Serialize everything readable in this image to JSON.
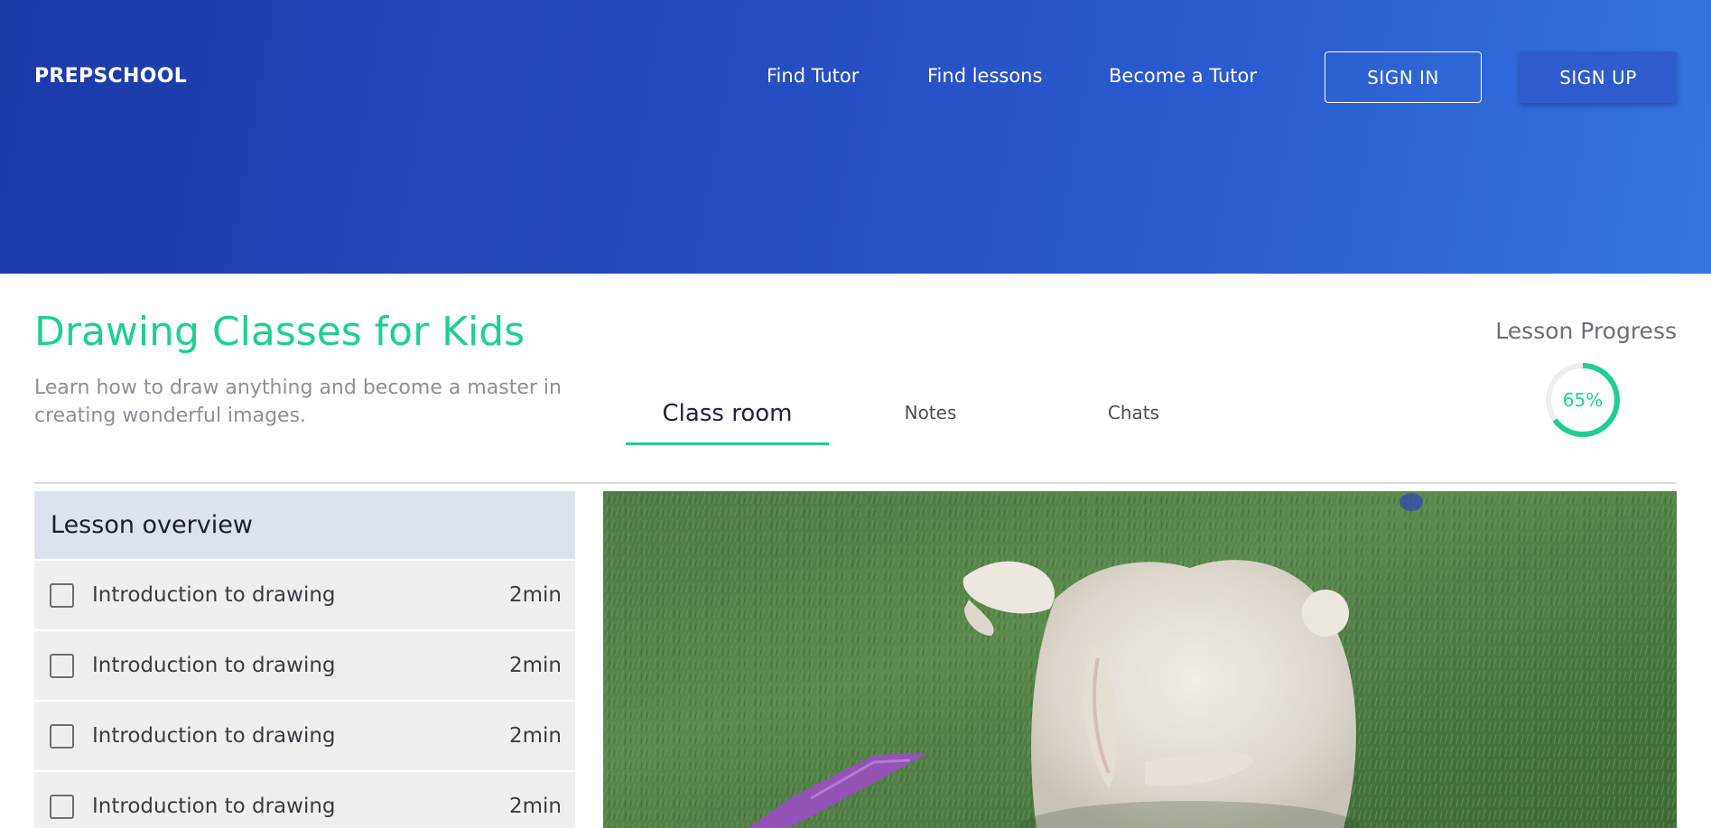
{
  "header": {
    "brand": "PREPSCHOOL",
    "nav": [
      "Find Tutor",
      "Find lessons",
      "Become a Tutor"
    ],
    "sign_in": "SIGN IN",
    "sign_up": "SIGN UP"
  },
  "course": {
    "title": "Drawing Classes for Kids",
    "description": "Learn how to draw anything and become a master in creating wonderful images."
  },
  "tabs": [
    {
      "label": "Class room",
      "active": true
    },
    {
      "label": "Notes",
      "active": false
    },
    {
      "label": "Chats",
      "active": false
    }
  ],
  "progress": {
    "label": "Lesson Progress",
    "value_text": "65%",
    "value": 0.65
  },
  "overview": {
    "title": "Lesson overview",
    "items": [
      {
        "name": "Introduction to drawing",
        "duration": "2min",
        "checked": false
      },
      {
        "name": "Introduction to drawing",
        "duration": "2min",
        "checked": false
      },
      {
        "name": "Introduction to drawing",
        "duration": "2min",
        "checked": false
      },
      {
        "name": "Introduction to drawing",
        "duration": "2min",
        "checked": false
      }
    ]
  },
  "colors": {
    "accent": "#1ecf94",
    "hero_start": "#1a3aa6",
    "hero_end": "#3474e2"
  }
}
